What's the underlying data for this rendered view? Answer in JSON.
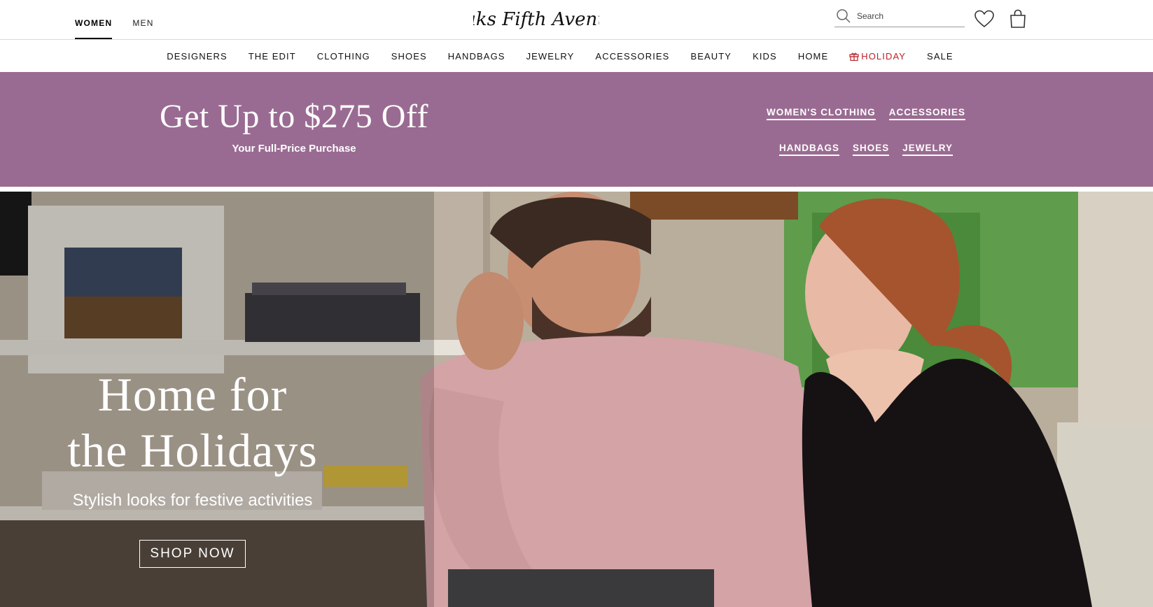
{
  "header": {
    "gender_tabs": [
      {
        "label": "WOMEN",
        "active": true
      },
      {
        "label": "MEN",
        "active": false
      }
    ],
    "logo_text": "Saks Fifth Avenue",
    "search": {
      "placeholder": "Search",
      "value": ""
    },
    "icons": {
      "search": "search-icon",
      "wishlist": "heart-icon",
      "bag": "shopping-bag-icon"
    }
  },
  "nav": {
    "items": [
      "DESIGNERS",
      "THE EDIT",
      "CLOTHING",
      "SHOES",
      "HANDBAGS",
      "JEWELRY",
      "ACCESSORIES",
      "BEAUTY",
      "KIDS",
      "HOME",
      "HOLIDAY",
      "SALE"
    ],
    "holiday_icon": "gift-icon",
    "holiday_color": "#b8222b"
  },
  "promo": {
    "headline": "Get Up to $275 Off",
    "subhead": "Your Full-Price Purchase",
    "links_row1": [
      "WOMEN'S CLOTHING",
      "ACCESSORIES"
    ],
    "links_row2": [
      "HANDBAGS",
      "SHOES",
      "JEWELRY"
    ],
    "background": "#9a6b92"
  },
  "hero": {
    "title_line1": "Home for",
    "title_line2": "the Holidays",
    "subtitle": "Stylish looks for festive activities",
    "cta": "SHOP NOW"
  }
}
